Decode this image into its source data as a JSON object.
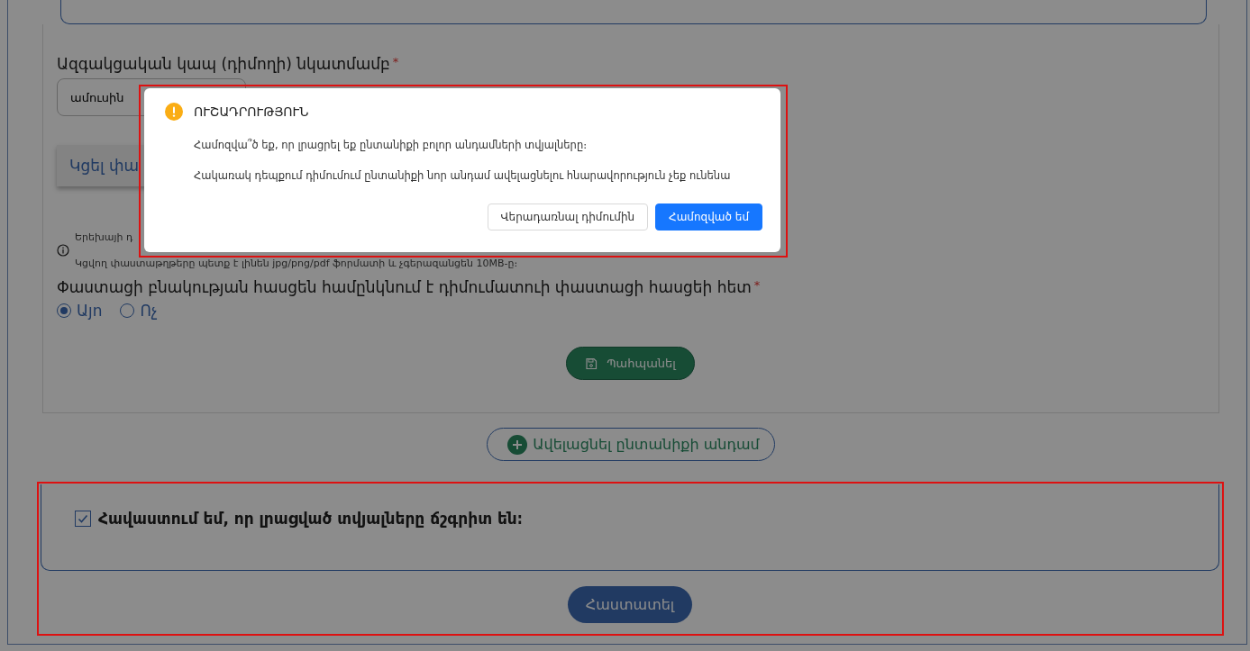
{
  "form": {
    "relation_field": {
      "label": "Ազգակցական կապ (դիմողի) նկատմամբ",
      "required_mark": "*",
      "value": "ամուսին"
    },
    "attach_button": "Կցել փա",
    "info_lines": [
      "Երեխայի դ",
      "Կցվող փաստաթղթերը պետք է լինեն jpg/png/pdf ֆորմատի և չգերազանցեն 10MB-ը։"
    ],
    "address_question": {
      "label": "Փաստացի բնակության հասցեն համընկնում է դիմումատուի փաստացի հասցեի հետ",
      "required_mark": "*",
      "options": [
        {
          "label": "Այո",
          "selected": true
        },
        {
          "label": "Ոչ",
          "selected": false
        }
      ]
    },
    "save_button": "Պահպանել"
  },
  "add_member_button": "Ավելացնել ընտանիքի անդամ",
  "agreement": {
    "label": "Հավաստում եմ, որ լրացված տվյալները ճշգրիտ են։",
    "checked": true
  },
  "confirm_button": "Հաստատել",
  "dialog": {
    "title": "ՈՒՇԱԴՐՈՒԹՅՈՒՆ",
    "messages": [
      "Համոզվա՞ծ եք, որ լրացրել եք ընտանիքի բոլոր անդամների տվյալները։",
      "Հակառակ դեպքում դիմումում ընտանիքի նոր անդամ ավելացնելու հնարավորություն չեք ունենա"
    ],
    "buttons": [
      {
        "label": "Վերադառնալ դիմումին",
        "kind": "secondary"
      },
      {
        "label": "Համոզված եմ",
        "kind": "primary"
      }
    ]
  }
}
